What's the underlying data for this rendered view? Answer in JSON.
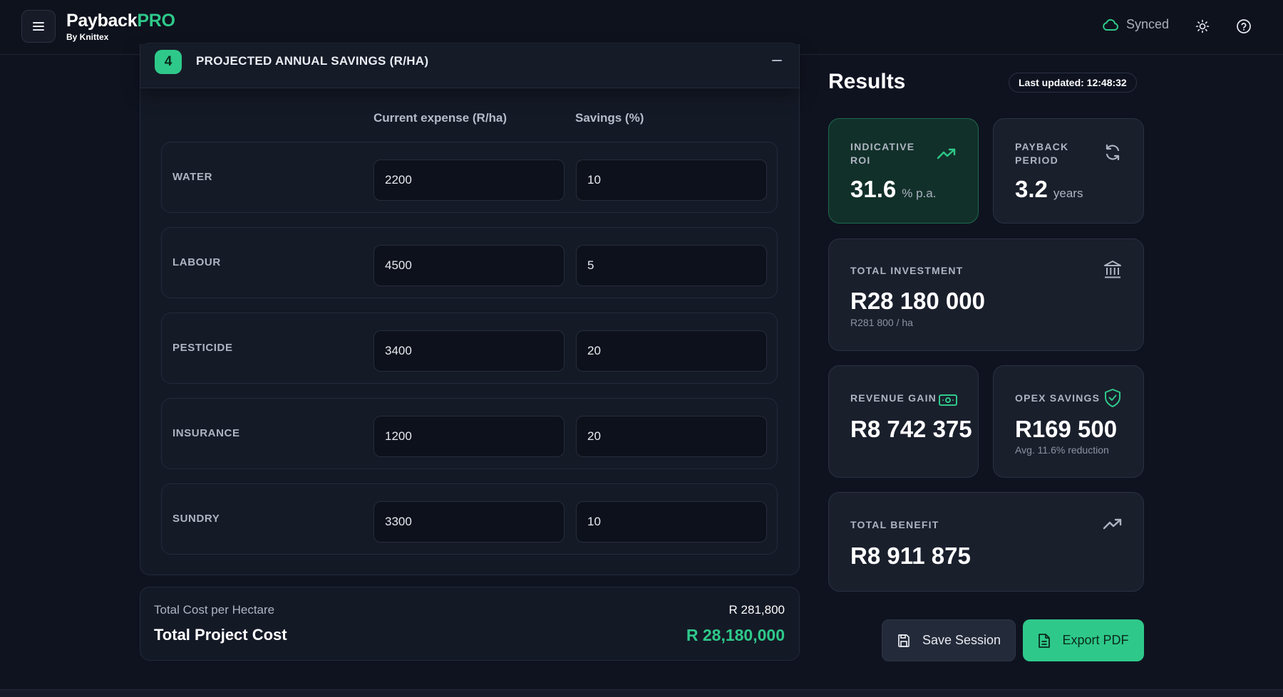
{
  "header": {
    "brand_main": "Payback",
    "brand_pro": "PRO",
    "brand_by": "By Knittex",
    "sync_status": "Synced"
  },
  "section": {
    "step": "4",
    "title": "PROJECTED ANNUAL SAVINGS (R/HA)",
    "col_expense": "Current expense (R/ha)",
    "col_savings": "Savings (%)",
    "rows": [
      {
        "label": "WATER",
        "expense": "2200",
        "savings": "10"
      },
      {
        "label": "LABOUR",
        "expense": "4500",
        "savings": "5"
      },
      {
        "label": "PESTICIDE",
        "expense": "3400",
        "savings": "20"
      },
      {
        "label": "INSURANCE",
        "expense": "1200",
        "savings": "20"
      },
      {
        "label": "SUNDRY",
        "expense": "3300",
        "savings": "10"
      }
    ]
  },
  "totals": {
    "per_hectare_label": "Total Cost per Hectare",
    "per_hectare_value": "R 281,800",
    "project_label": "Total Project Cost",
    "project_value": "R 28,180,000"
  },
  "results": {
    "title": "Results",
    "last_updated": "Last updated: 12:48:32",
    "roi": {
      "label_1": "INDICATIVE",
      "label_2": "ROI",
      "value": "31.6",
      "unit": "% p.a."
    },
    "payback": {
      "label_1": "PAYBACK",
      "label_2": "PERIOD",
      "value": "3.2",
      "unit": "years"
    },
    "investment": {
      "label": "TOTAL INVESTMENT",
      "value": "R28 180 000",
      "sub": "R281 800 / ha"
    },
    "revenue": {
      "label": "REVENUE GAIN",
      "value": "R8 742 375"
    },
    "opex": {
      "label": "OPEX SAVINGS",
      "value": "R169 500",
      "sub": "Avg. 11.6% reduction"
    },
    "benefit": {
      "label": "TOTAL BENEFIT",
      "value": "R8 911 875"
    }
  },
  "actions": {
    "save_label": "Save Session",
    "export_label": "Export PDF"
  },
  "colors": {
    "accent": "#2ec98a",
    "background": "#0f1320",
    "card": "#1a1f2c"
  },
  "icons": [
    "menu-icon",
    "cloud-icon",
    "sun-icon",
    "help-icon",
    "minus-icon",
    "trend-up-icon",
    "refresh-icon",
    "bank-icon",
    "money-icon",
    "shield-check-icon",
    "save-icon",
    "file-icon"
  ]
}
